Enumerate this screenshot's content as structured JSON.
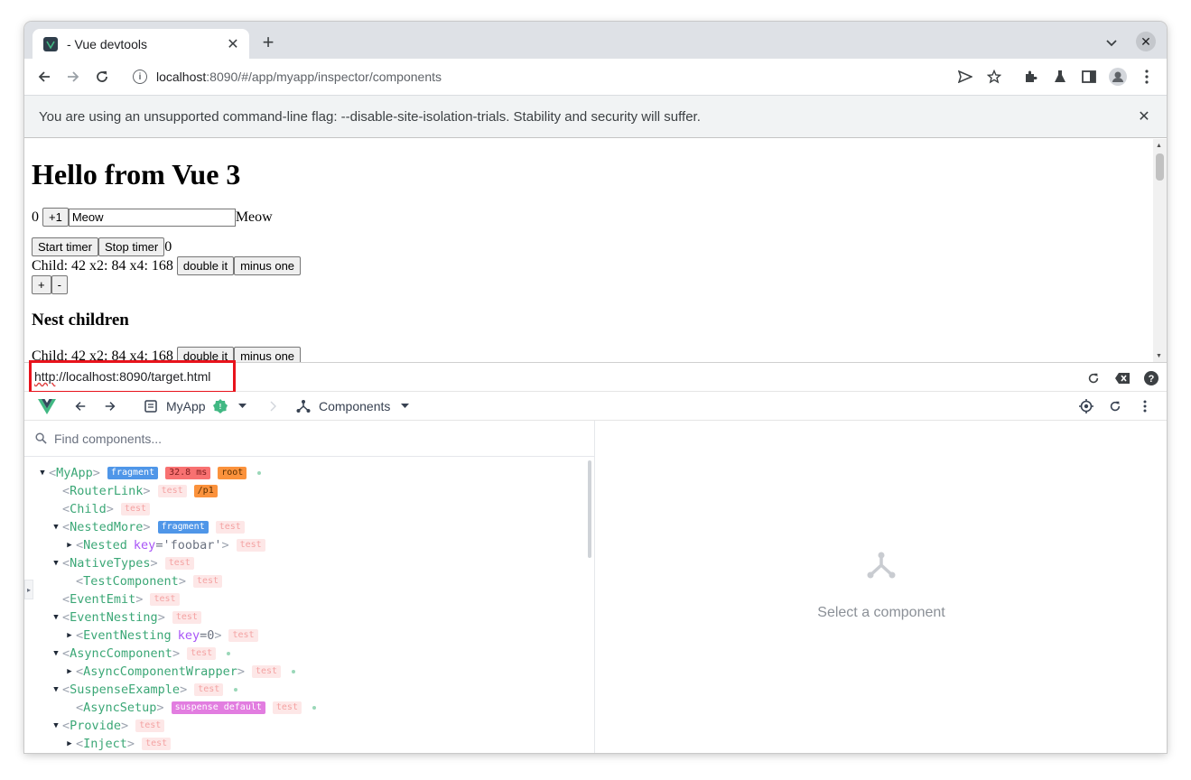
{
  "browser": {
    "tab_title": "- Vue devtools",
    "url_host": "localhost",
    "url_rest": ":8090/#/app/myapp/inspector/components",
    "infobar_text": "You are using an unsupported command-line flag: --disable-site-isolation-trials. Stability and security will suffer."
  },
  "page": {
    "heading": "Hello from Vue 3",
    "counter_value": "0",
    "plus_one_label": "+1",
    "input_value": "Meow",
    "echo_text": "Meow",
    "start_timer_label": "Start timer",
    "stop_timer_label": "Stop timer",
    "timer_value": "0",
    "child_text": "Child: 42 x2: 84 x4: 168",
    "double_it_label": "double it",
    "minus_one_label": "minus one",
    "plus_label": "+",
    "minus_label": "-",
    "nest_heading": "Nest children",
    "child_text_2": "Child: 42 x2: 84 x4: 168",
    "double_it_label_2": "double it",
    "minus_one_label_2": "minus one"
  },
  "devtools": {
    "target_url_prefix": "http",
    "target_url_rest": "://localhost:8090/target.html",
    "app_name": "MyApp",
    "section": "Components",
    "search_placeholder": "Find components...",
    "empty_text": "Select a component",
    "tree": [
      {
        "name": "MyApp",
        "arrow": "down",
        "indent": 0,
        "badges": [
          {
            "text": "fragment",
            "kind": "fragment"
          },
          {
            "text": "32.8 ms",
            "kind": "ms"
          },
          {
            "text": "root",
            "kind": "root"
          }
        ],
        "dot": true
      },
      {
        "name": "RouterLink",
        "arrow": "none",
        "indent": 1,
        "badges": [
          {
            "text": "test",
            "kind": "test"
          },
          {
            "text": "/p1",
            "kind": "p1"
          }
        ],
        "dot": false
      },
      {
        "name": "Child",
        "arrow": "none",
        "indent": 1,
        "badges": [
          {
            "text": "test",
            "kind": "test"
          }
        ],
        "dot": false
      },
      {
        "name": "NestedMore",
        "arrow": "down",
        "indent": 1,
        "badges": [
          {
            "text": "fragment",
            "kind": "fragment"
          },
          {
            "text": "test",
            "kind": "test"
          }
        ],
        "dot": false
      },
      {
        "name": "Nested",
        "arrow": "right",
        "indent": 2,
        "attr_key": "key",
        "attr_val": "='foobar'",
        "badges": [
          {
            "text": "test",
            "kind": "test"
          }
        ],
        "dot": false
      },
      {
        "name": "NativeTypes",
        "arrow": "down",
        "indent": 1,
        "badges": [
          {
            "text": "test",
            "kind": "test"
          }
        ],
        "dot": false
      },
      {
        "name": "TestComponent",
        "arrow": "none",
        "indent": 2,
        "badges": [
          {
            "text": "test",
            "kind": "test"
          }
        ],
        "dot": false
      },
      {
        "name": "EventEmit",
        "arrow": "none",
        "indent": 1,
        "badges": [
          {
            "text": "test",
            "kind": "test"
          }
        ],
        "dot": false
      },
      {
        "name": "EventNesting",
        "arrow": "down",
        "indent": 1,
        "badges": [
          {
            "text": "test",
            "kind": "test"
          }
        ],
        "dot": false
      },
      {
        "name": "EventNesting",
        "arrow": "right",
        "indent": 2,
        "attr_key": "key",
        "attr_val": "=0",
        "badges": [
          {
            "text": "test",
            "kind": "test"
          }
        ],
        "dot": false
      },
      {
        "name": "AsyncComponent",
        "arrow": "down",
        "indent": 1,
        "badges": [
          {
            "text": "test",
            "kind": "test"
          }
        ],
        "dot": true
      },
      {
        "name": "AsyncComponentWrapper",
        "arrow": "right",
        "indent": 2,
        "badges": [
          {
            "text": "test",
            "kind": "test"
          }
        ],
        "dot": true
      },
      {
        "name": "SuspenseExample",
        "arrow": "down",
        "indent": 1,
        "badges": [
          {
            "text": "test",
            "kind": "test"
          }
        ],
        "dot": true
      },
      {
        "name": "AsyncSetup",
        "arrow": "none",
        "indent": 2,
        "badges": [
          {
            "text": "suspense default",
            "kind": "suspense"
          },
          {
            "text": "test",
            "kind": "test"
          }
        ],
        "dot": true
      },
      {
        "name": "Provide",
        "arrow": "down",
        "indent": 1,
        "badges": [
          {
            "text": "test",
            "kind": "test"
          }
        ],
        "dot": false
      },
      {
        "name": "Inject",
        "arrow": "right",
        "indent": 2,
        "badges": [
          {
            "text": "test",
            "kind": "test"
          }
        ],
        "dot": false
      }
    ]
  },
  "colors": {
    "vue_green": "#41b883",
    "highlight": "#e8131c",
    "tag_green": "#3ba776"
  }
}
